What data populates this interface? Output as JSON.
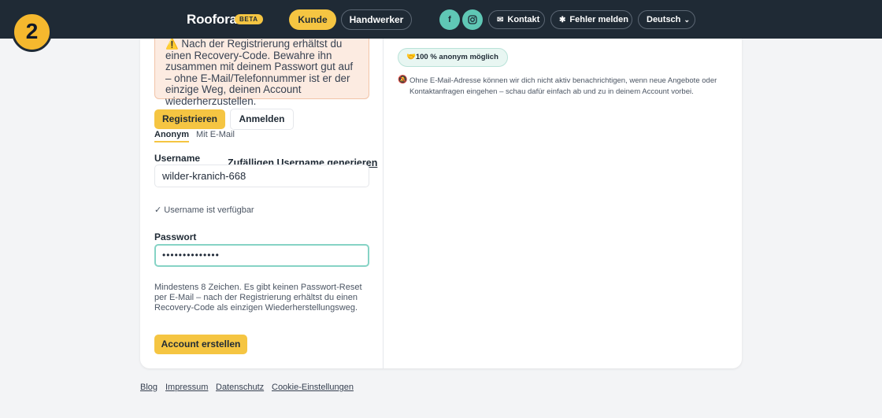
{
  "header": {
    "brand": "Roofora",
    "badge": "BETA",
    "nav": {
      "kunde": "Kunde",
      "handwerker": "Handwerker"
    },
    "social": {
      "facebook": "f",
      "instagram_icon": "instagram-icon"
    },
    "kontakt": "Kontakt",
    "fehler": "Fehler melden",
    "language": "Deutsch"
  },
  "step_badge": "2",
  "form": {
    "warning": "⚠️ Nach der Registrierung erhältst du einen Recovery-Code. Bewahre ihn zusammen mit deinem Passwort gut auf – ohne E-Mail/Telefonnummer ist er der einzige Weg, deinen Account wiederherzustellen.",
    "register_label": "Registrieren",
    "login_label": "Anmelden",
    "tabs": {
      "anonym": "Anonym",
      "email": "Mit E-Mail"
    },
    "username_label": "Username",
    "generate_link": "Zufälligen Username generieren",
    "username_value": "wilder-kranich-668",
    "available": "✓ Username ist verfügbar",
    "password_label": "Passwort",
    "password_value": "••••••••••••••",
    "hint": "Mindestens 8 Zeichen. Es gibt keinen Passwort-Reset per E-Mail – nach der Registrierung erhältst du einen Recovery-Code als einzigen Wiederherstellungsweg.",
    "create_label": "Account erstellen"
  },
  "info": {
    "anon_pill": "🤝100 % anonym möglich",
    "note_icon": "🔕",
    "note": "Ohne E-Mail-Adresse können wir dich nicht aktiv benachrichtigen, wenn neue Angebote oder Kontaktanfragen eingehen – schau dafür einfach ab und zu in deinem Account vorbei."
  },
  "footer": [
    "Blog",
    "Impressum",
    "Datenschutz",
    "Cookie-Einstellungen"
  ],
  "colors": {
    "topbar": "#1f2a35",
    "accent": "#f5c542",
    "teal": "#5fc7b5"
  }
}
